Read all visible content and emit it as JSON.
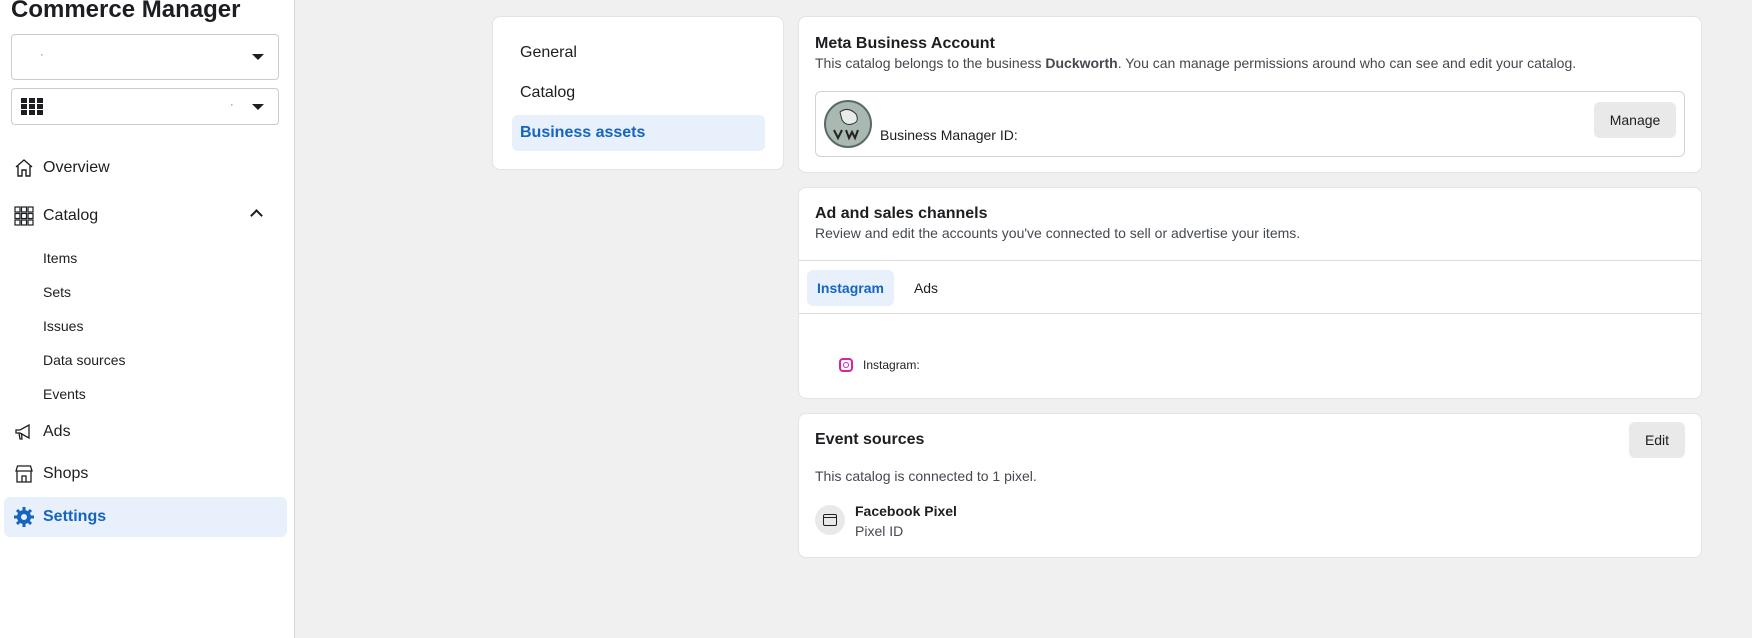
{
  "app": {
    "title": "Commerce Manager"
  },
  "selectors": {
    "catalog_value": "·",
    "account_value": "·"
  },
  "sidebar": {
    "overview": "Overview",
    "catalog": "Catalog",
    "catalog_items": [
      "Items",
      "Sets",
      "Issues",
      "Data sources",
      "Events"
    ],
    "ads": "Ads",
    "shops": "Shops",
    "settings": "Settings"
  },
  "settings_nav": {
    "items": [
      "General",
      "Catalog",
      "Business assets"
    ],
    "active": "Business assets"
  },
  "business_account": {
    "title": "Meta Business Account",
    "desc_prefix": "This catalog belongs to the business ",
    "business_name": "Duckworth",
    "desc_suffix": ". You can manage permissions around who can see and edit your catalog.",
    "bm_id_label": "Business Manager ID:",
    "manage_label": "Manage"
  },
  "channels": {
    "title": "Ad and sales channels",
    "desc": "Review and edit the accounts you've connected to sell or advertise your items.",
    "tabs": [
      "Instagram",
      "Ads"
    ],
    "active_tab": "Instagram",
    "instagram_label": "Instagram:"
  },
  "event_sources": {
    "title": "Event sources",
    "edit_label": "Edit",
    "desc": "This catalog is connected to 1 pixel.",
    "pixel_name": "Facebook Pixel",
    "pixel_id_label": "Pixel ID"
  },
  "colors": {
    "accent": "#1565c0",
    "active_bg": "#e7f0fb",
    "page_bg": "#f0f0f0"
  }
}
